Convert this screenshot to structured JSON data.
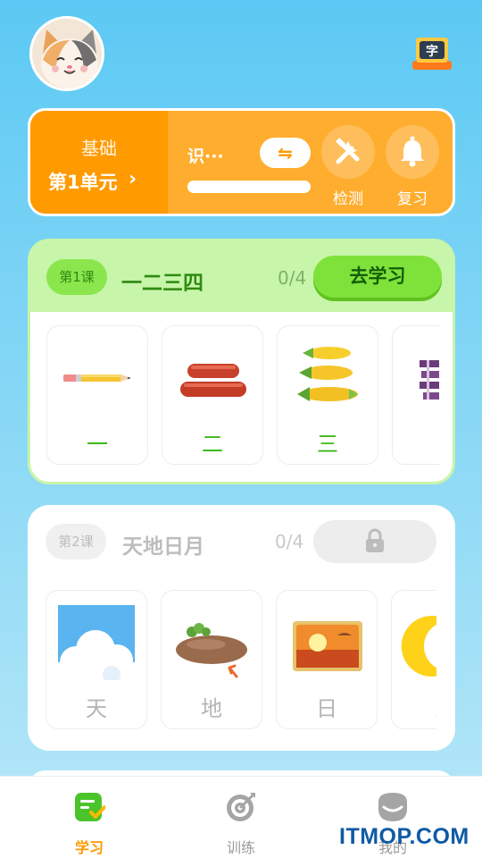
{
  "header": {
    "avatar_icon": "cat-avatar",
    "dictionary_icon": "dictionary-icon",
    "dictionary_char": "字"
  },
  "unit_banner": {
    "level": "基础",
    "unit": "第1单元",
    "progress_label": "识···",
    "progress_fraction": 0,
    "swap_icon": "⇋",
    "actions": [
      {
        "label": "检测",
        "icon": "tools-icon"
      },
      {
        "label": "复习",
        "icon": "bell-icon"
      }
    ]
  },
  "lessons": [
    {
      "badge": "第1课",
      "title": "一二三四",
      "count": "0/4",
      "action_label": "去学习",
      "locked": false,
      "tiles": [
        {
          "char": "一",
          "image": "pencil"
        },
        {
          "char": "二",
          "image": "sausages"
        },
        {
          "char": "三",
          "image": "corn"
        },
        {
          "char": "[",
          "image": "sugarcane"
        }
      ]
    },
    {
      "badge": "第2课",
      "title": "天地日月",
      "count": "0/4",
      "locked": true,
      "tiles": [
        {
          "char": "天",
          "image": "sky-clouds"
        },
        {
          "char": "地",
          "image": "ground"
        },
        {
          "char": "日",
          "image": "sunset"
        },
        {
          "char": "丿",
          "image": "moon"
        }
      ]
    }
  ],
  "tabbar": [
    {
      "label": "学习",
      "icon": "study-icon",
      "active": true
    },
    {
      "label": "训练",
      "icon": "target-icon",
      "active": false
    },
    {
      "label": "我的",
      "icon": "profile-icon",
      "active": false
    }
  ],
  "watermark": "ITMOP.COM",
  "colors": {
    "accent_orange": "#ff9a00",
    "accent_green": "#7fe23a",
    "background_top": "#5cc9f4"
  }
}
